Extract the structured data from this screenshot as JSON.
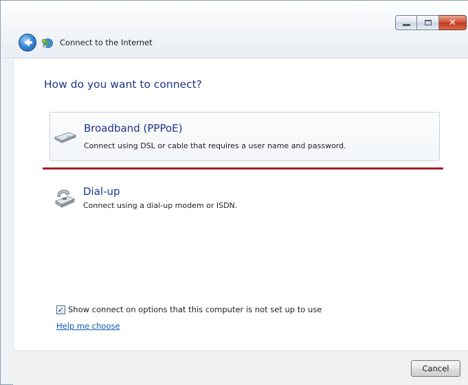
{
  "window": {
    "title": "Connect to the Internet"
  },
  "page": {
    "heading": "How do you want to connect?"
  },
  "options": [
    {
      "title": "Broadband (PPPoE)",
      "description": "Connect using DSL or cable that requires a user name and password.",
      "icon": "broadband-modem-icon",
      "selected": true
    },
    {
      "title": "Dial-up",
      "description": "Connect using a dial-up modem or ISDN.",
      "icon": "dialup-modem-icon",
      "selected": false
    }
  ],
  "show_options": {
    "label": "Show connect on options that this computer is not set up to use",
    "checked": true
  },
  "help_link": "Help me choose",
  "footer": {
    "cancel_label": "Cancel"
  },
  "colors": {
    "heading": "#1e3287",
    "link": "#0b57b8",
    "selection_rule": "#a51d24"
  }
}
